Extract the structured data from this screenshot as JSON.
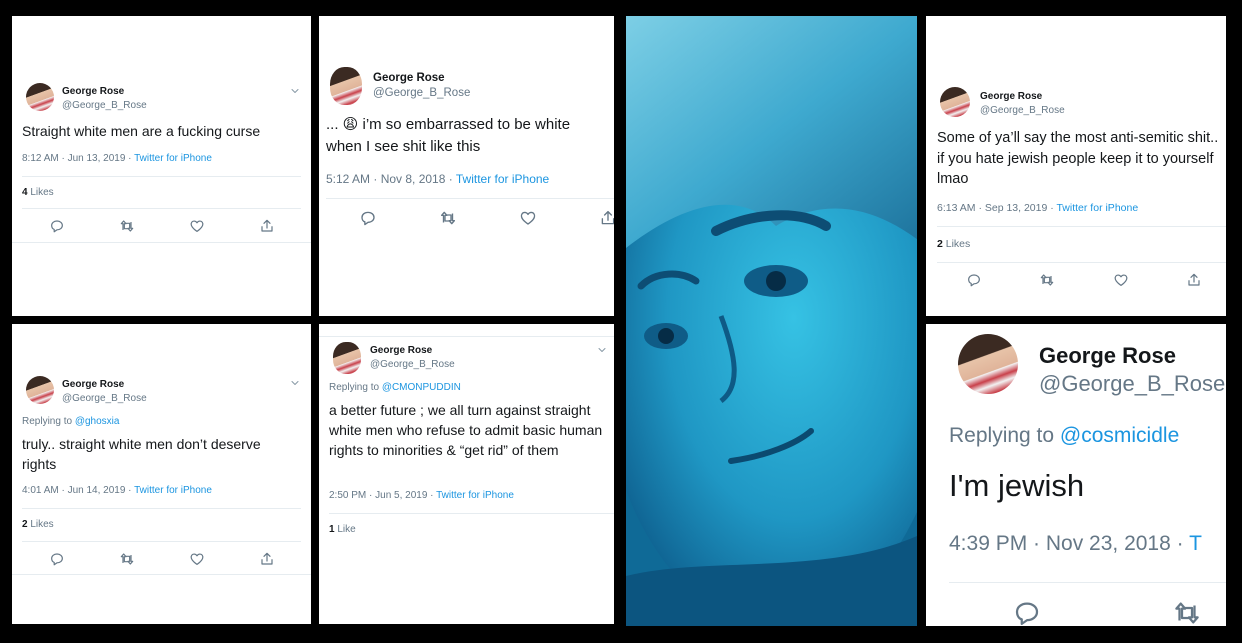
{
  "tweets": [
    {
      "name": "George Rose",
      "handle": "@George_B_Rose",
      "text": "Straight white men are a fucking curse",
      "time": "8:12 AM · Jun 13, 2019 · ",
      "source": "Twitter for iPhone",
      "likes_count": "4",
      "likes_label": " Likes"
    },
    {
      "name": "George Rose",
      "handle": "@George_B_Rose",
      "text_prefix": "... ",
      "emoji": "😩",
      "text": " i’m so embarrassed to be white when I see shit like this",
      "time": "5:12 AM · Nov 8, 2018 · ",
      "source": "Twitter for iPhone"
    },
    {
      "name": "George Rose",
      "handle": "@George_B_Rose",
      "text": "Some of ya’ll say the most anti-semitic shit.. if you hate jewish people keep it to yourself lmao",
      "time": "6:13 AM · Sep 13, 2019 · ",
      "source": "Twitter for iPhone",
      "likes_count": "2",
      "likes_label": " Likes"
    },
    {
      "name": "George Rose",
      "handle": "@George_B_Rose",
      "reply_prefix": "Replying to ",
      "reply_to": "@ghosxia",
      "text": "truly.. straight white men don’t deserve rights",
      "time": "4:01 AM · Jun 14, 2019 · ",
      "source": "Twitter for iPhone",
      "likes_count": "2",
      "likes_label": " Likes"
    },
    {
      "name": "George Rose",
      "handle": "@George_B_Rose",
      "reply_prefix": "Replying to ",
      "reply_to": "@CMONPUDDIN",
      "text": "a better future ; we all turn against straight white men who refuse to admit basic human rights to minorities & “get rid” of them",
      "time": "2:50 PM · Jun 5, 2019 · ",
      "source": "Twitter for iPhone",
      "likes_count": "1",
      "likes_label": " Like"
    },
    {
      "name": "George Rose",
      "handle": "@George_B_Rose",
      "reply_prefix": "Replying to ",
      "reply_to": "@cosmicidle",
      "text": "I'm jewish",
      "time": "4:39 PM · Nov 23, 2018 · ",
      "source": "T"
    }
  ],
  "icons": {
    "reply": "reply-icon",
    "retweet": "retweet-icon",
    "like": "heart-icon",
    "share": "share-icon",
    "more": "chevron-down-icon"
  },
  "colors": {
    "link": "#1b95e0",
    "muted": "#657786",
    "background": "#000000"
  }
}
